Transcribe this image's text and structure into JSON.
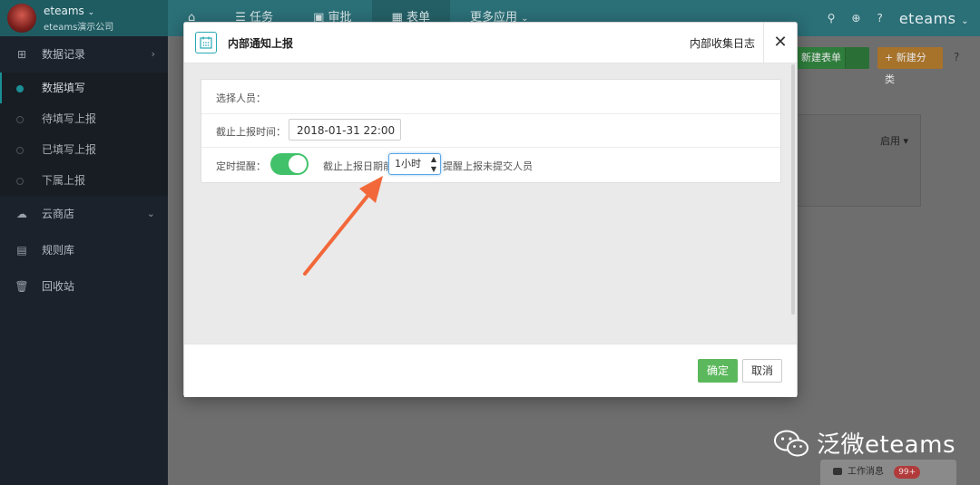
{
  "header": {
    "user": "eteams",
    "company": "eteams演示公司",
    "nav": [
      "任务",
      "审批",
      "表单",
      "更多应用"
    ],
    "brand_logo": "eteams"
  },
  "sidebar": {
    "items": [
      {
        "label": "数据记录",
        "icon": "grid-icon"
      },
      {
        "label": "云商店",
        "icon": "cloud-icon"
      },
      {
        "label": "规则库",
        "icon": "server-icon"
      },
      {
        "label": "回收站",
        "icon": "trash-icon"
      }
    ],
    "sub_items": [
      "数据填写",
      "待填写上报",
      "已填写上报",
      "下属上报"
    ]
  },
  "content": {
    "new_form_btn": "新建表单",
    "new_category_btn": "+ 新建分类",
    "enable_label": "启用"
  },
  "modal": {
    "title": "内部通知上报",
    "header_link": "内部收集日志",
    "fields": {
      "select_people_label": "选择人员：",
      "deadline_label": "截止上报时间：",
      "deadline_value": "2018-01-31 22:00",
      "reminder_label": "定时提醒：",
      "reminder_enabled": true,
      "reminder_before": "截止上报日期前",
      "reminder_interval": "1小时",
      "reminder_after": "提醒上报未提交人员"
    },
    "ok_label": "确定",
    "cancel_label": "取消"
  },
  "watermark": "泛微eteams",
  "work_message": {
    "label": "工作消息",
    "count": "99+"
  },
  "colors": {
    "topbar": "#2b6f77",
    "sidebar": "#1c222b",
    "toggle_on": "#41c26a",
    "ok_button": "#5cb85c",
    "arrow": "#f2683a"
  }
}
